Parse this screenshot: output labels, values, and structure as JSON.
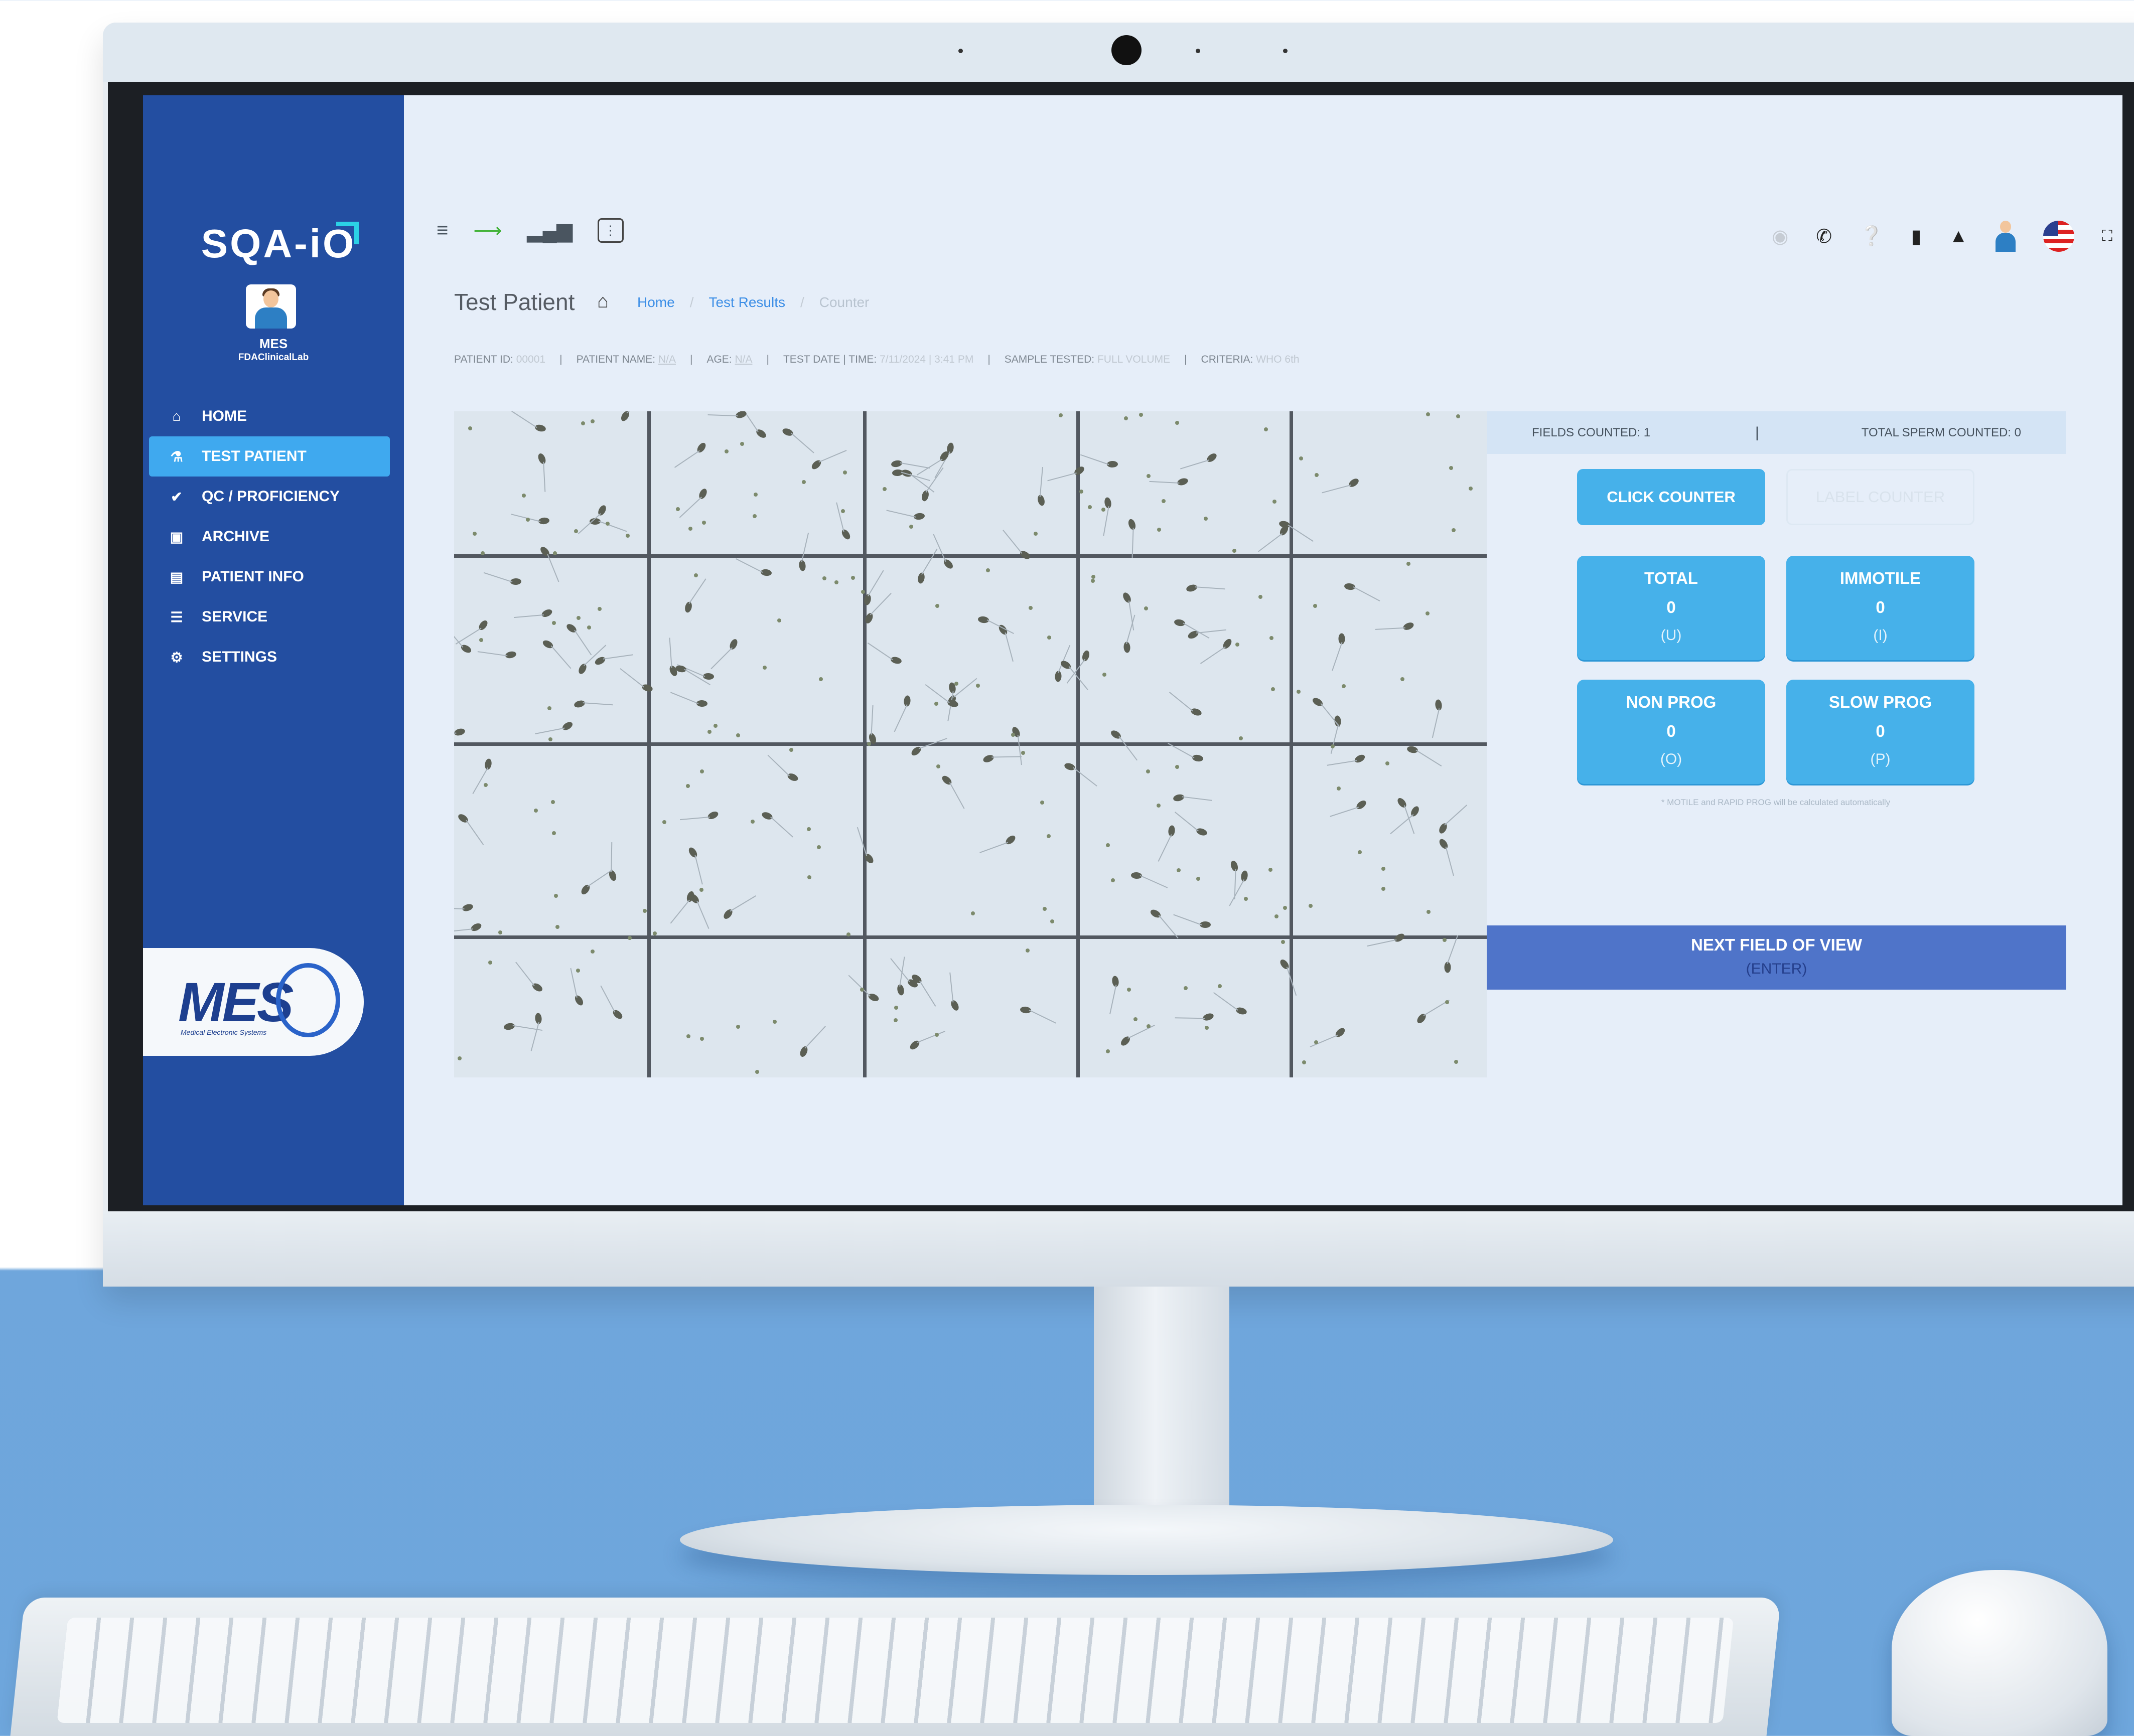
{
  "app": {
    "logo": "SQA-iO",
    "user_name": "MES",
    "user_lab": "FDAClinicalLab"
  },
  "sidebar": {
    "items": [
      {
        "label": "HOME",
        "icon": "home-icon",
        "active": false
      },
      {
        "label": "TEST PATIENT",
        "icon": "flask-icon",
        "active": true
      },
      {
        "label": "QC / PROFICIENCY",
        "icon": "check-tag-icon",
        "active": false
      },
      {
        "label": "ARCHIVE",
        "icon": "archive-icon",
        "active": false
      },
      {
        "label": "PATIENT INFO",
        "icon": "patient-card-icon",
        "active": false
      },
      {
        "label": "SERVICE",
        "icon": "list-icon",
        "active": false
      },
      {
        "label": "SETTINGS",
        "icon": "gear-icon",
        "active": false
      }
    ],
    "brand_badge": {
      "text": "MES",
      "sub": "Medical Electronic Systems"
    }
  },
  "topbar": {
    "left_icons": [
      "menu-icon",
      "usb-icon",
      "signal-icon",
      "device-icon"
    ],
    "right_icons": [
      "eye-icon",
      "phone-icon",
      "help-icon",
      "document-icon",
      "bell-icon",
      "doctor-avatar",
      "us-flag-icon",
      "fullscreen-icon"
    ]
  },
  "page": {
    "title": "Test Patient",
    "breadcrumbs": [
      "Home",
      "Test Results",
      "Counter"
    ]
  },
  "patient_info": {
    "patient_id_label": "PATIENT ID:",
    "patient_id": "00001",
    "patient_name_label": "PATIENT NAME:",
    "patient_name": "N/A",
    "age_label": "AGE:",
    "age": "N/A",
    "test_date_label": "TEST DATE | TIME:",
    "test_date": "7/11/2024 | 3:41 PM",
    "sample_label": "SAMPLE TESTED:",
    "sample": "FULL VOLUME",
    "criteria_label": "CRITERIA:",
    "criteria": "WHO 6th"
  },
  "counter": {
    "fields_counted": "FIELDS COUNTED: 1",
    "stats_separator": "|",
    "total_sperm_counted": "TOTAL SPERM COUNTED: 0",
    "click_counter_label": "CLICK COUNTER",
    "label_counter_label": "LABEL COUNTER",
    "tiles": [
      {
        "label": "TOTAL",
        "count": "0",
        "key": "(U)"
      },
      {
        "label": "IMMOTILE",
        "count": "0",
        "key": "(I)"
      },
      {
        "label": "NON PROG",
        "count": "0",
        "key": "(O)"
      },
      {
        "label": "SLOW PROG",
        "count": "0",
        "key": "(P)"
      }
    ],
    "hint": "* MOTILE and RAPID PROG will be calculated automatically",
    "next_label": "NEXT FIELD OF VIEW",
    "next_key": "(ENTER)"
  },
  "colors": {
    "sidebar": "#234ea1",
    "active_item": "#3fa9ef",
    "tile": "#46b1ea",
    "next_button": "#4f74c9",
    "background": "#e6eef9"
  }
}
